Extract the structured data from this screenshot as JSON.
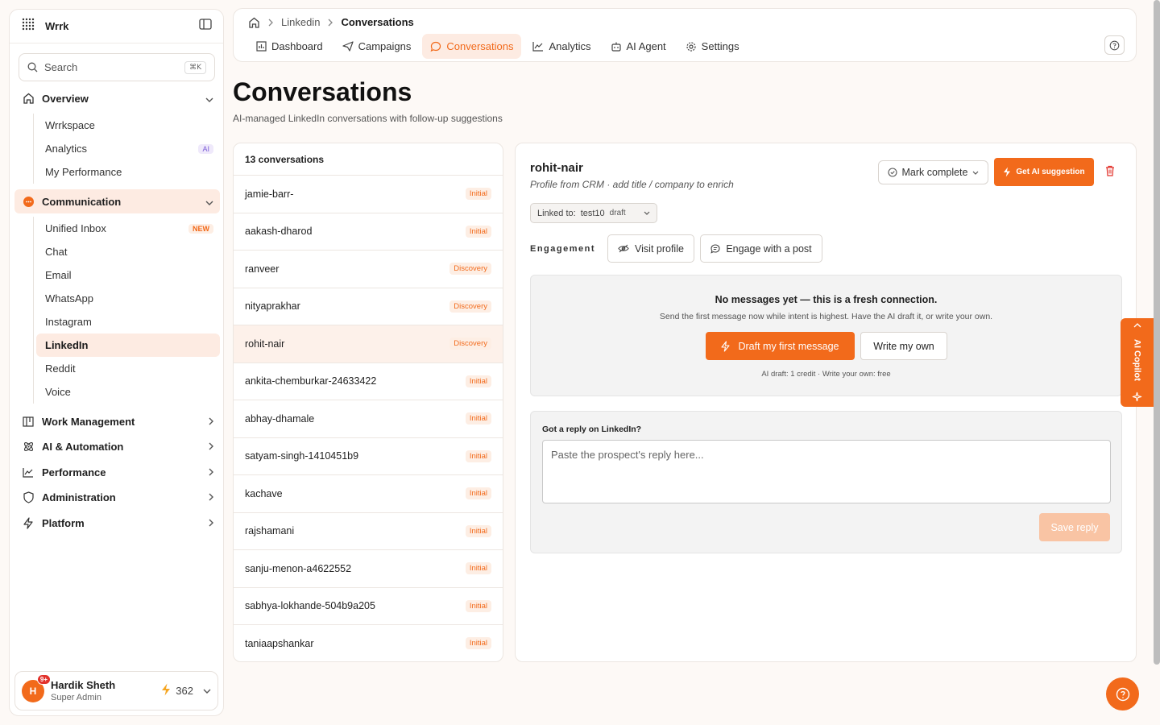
{
  "sidebar": {
    "brand": "Wrrk",
    "search": {
      "label": "Search",
      "shortcut": "⌘K"
    },
    "groups": {
      "overview": {
        "label": "Overview",
        "items": [
          {
            "label": "Wrrkspace"
          },
          {
            "label": "Analytics",
            "badge": "AI"
          },
          {
            "label": "My Performance"
          }
        ]
      },
      "communication": {
        "label": "Communication",
        "items": [
          {
            "label": "Unified Inbox",
            "badge": "NEW"
          },
          {
            "label": "Chat"
          },
          {
            "label": "Email"
          },
          {
            "label": "WhatsApp"
          },
          {
            "label": "Instagram"
          },
          {
            "label": "LinkedIn"
          },
          {
            "label": "Reddit"
          },
          {
            "label": "Voice"
          }
        ]
      },
      "work": {
        "label": "Work Management"
      },
      "ai": {
        "label": "AI & Automation"
      },
      "performance": {
        "label": "Performance"
      },
      "admin": {
        "label": "Administration"
      },
      "platform": {
        "label": "Platform"
      }
    },
    "user": {
      "initial": "H",
      "notif": "9+",
      "name": "Hardik Sheth",
      "role": "Super Admin",
      "credits": "362"
    }
  },
  "topbar": {
    "breadcrumb": {
      "parent": "Linkedin",
      "current": "Conversations"
    },
    "tabs": [
      "Dashboard",
      "Campaigns",
      "Conversations",
      "Analytics",
      "AI Agent",
      "Settings"
    ]
  },
  "page": {
    "title": "Conversations",
    "subtitle": "AI-managed LinkedIn conversations with follow-up suggestions"
  },
  "conversations": {
    "count_label": "13 conversations",
    "rows": [
      {
        "name": "jamie-barr-",
        "stage": "Initial"
      },
      {
        "name": "aakash-dharod",
        "stage": "Initial"
      },
      {
        "name": "ranveer",
        "stage": "Discovery"
      },
      {
        "name": "nityaprakhar",
        "stage": "Discovery"
      },
      {
        "name": "rohit-nair",
        "stage": "Discovery"
      },
      {
        "name": "ankita-chemburkar-24633422",
        "stage": "Initial"
      },
      {
        "name": "abhay-dhamale",
        "stage": "Initial"
      },
      {
        "name": "satyam-singh-1410451b9",
        "stage": "Initial"
      },
      {
        "name": "kachave",
        "stage": "Initial"
      },
      {
        "name": "rajshamani",
        "stage": "Initial"
      },
      {
        "name": "sanju-menon-a4622552",
        "stage": "Initial"
      },
      {
        "name": "sabhya-lokhande-504b9a205",
        "stage": "Initial"
      },
      {
        "name": "taniaapshankar",
        "stage": "Initial"
      }
    ]
  },
  "detail": {
    "name": "rohit-nair",
    "profile_note": "Profile from CRM · add title / company to enrich",
    "mark_complete": "Mark complete",
    "ai_suggestion": "Get AI suggestion",
    "linked_label": "Linked to:",
    "linked_value": "test10",
    "linked_status": "draft",
    "engagement_label": "Engagement",
    "visit_profile": "Visit profile",
    "engage_post": "Engage with a post",
    "empty_title": "No messages yet — this is a fresh connection.",
    "empty_sub": "Send the first message now while intent is highest. Have the AI draft it, or write your own.",
    "draft_btn": "Draft my first message",
    "own_btn": "Write my own",
    "empty_note": "AI draft: 1 credit · Write your own: free",
    "reply_label": "Got a reply on LinkedIn?",
    "reply_placeholder": "Paste the prospect's reply here...",
    "save_reply": "Save reply"
  },
  "copilot": {
    "label": "AI Copilot"
  },
  "colors": {
    "accent": "#f26a1b",
    "accent_soft": "#fdebe2"
  }
}
